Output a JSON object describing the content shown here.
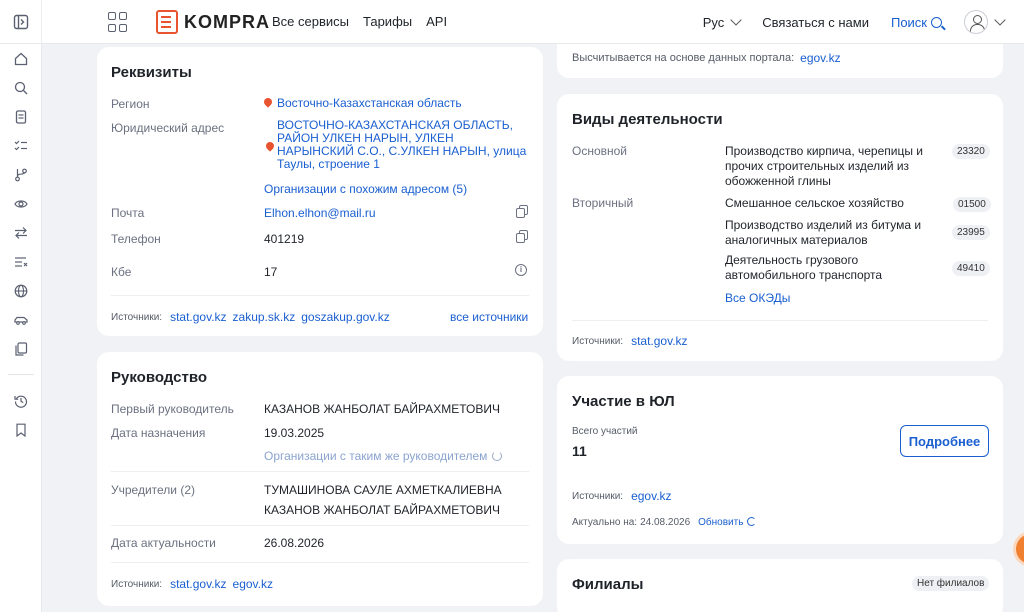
{
  "header": {
    "logo_text": "KOMPRA",
    "nav": [
      "Все сервисы",
      "Тарифы",
      "API"
    ],
    "lang": "Рус",
    "contact": "Связаться с нами",
    "search": "Поиск"
  },
  "rekvizity": {
    "title": "Реквизиты",
    "region_label": "Регион",
    "region_value": "Восточно-Казахстанская область",
    "address_label": "Юридический адрес",
    "address_value": "ВОСТОЧНО-КАЗАХСТАНСКАЯ ОБЛАСТЬ, РАЙОН УЛКЕН НАРЫН, УЛКЕН НАРЫНСКИЙ С.О., С.УЛКЕН НАРЫН, улица Таулы, строение 1",
    "similar_address": "Организации с похожим адресом (5)",
    "email_label": "Почта",
    "email_value": "Elhon.elhon@mail.ru",
    "phone_label": "Телефон",
    "phone_value": "401219",
    "kbe_label": "Кбе",
    "kbe_value": "17",
    "sources_label": "Источники:",
    "sources": [
      "stat.gov.kz",
      "zakup.sk.kz",
      "goszakup.gov.kz"
    ],
    "all_sources": "все источники"
  },
  "rukovodstvo": {
    "title": "Руководство",
    "head_label": "Первый руководитель",
    "head_value": "КАЗАНОВ ЖАНБОЛАТ БАЙРАХМЕТОВИЧ",
    "date_label": "Дата назначения",
    "date_value": "19.03.2025",
    "same_head": "Организации с таким же руководителем",
    "founders_label": "Учредители (2)",
    "founders": [
      "ТУМАШИНОВА САУЛЕ АХМЕТКАЛИЕВНА",
      "КАЗАНОВ ЖАНБОЛАТ БАЙРАХМЕТОВИЧ"
    ],
    "actual_label": "Дата актуальности",
    "actual_value": "26.08.2026",
    "sources_label": "Источники:",
    "sources": [
      "stat.gov.kz",
      "egov.kz"
    ]
  },
  "top_right": {
    "text": "Высчитывается на основе данных портала:",
    "link": "egov.kz"
  },
  "activities": {
    "title": "Виды деятельности",
    "main_label": "Основной",
    "secondary_label": "Вторичный",
    "main": [
      {
        "name": "Производство кирпича, черепицы и прочих строительных изделий из обожженной глины",
        "code": "23320"
      }
    ],
    "secondary": [
      {
        "name": "Смешанное сельское хозяйство",
        "code": "01500"
      },
      {
        "name": "Производство изделий из битума и аналогичных материалов",
        "code": "23995"
      },
      {
        "name": "Деятельность грузового автомобильного транспорта",
        "code": "49410"
      }
    ],
    "all_okeds": "Все ОКЭДы",
    "sources_label": "Источники:",
    "source": "stat.gov.kz"
  },
  "participation": {
    "title": "Участие в ЮЛ",
    "total_label": "Всего участий",
    "total_value": "11",
    "more_button": "Подробнее",
    "sources_label": "Источники:",
    "source": "egov.kz",
    "actual_label": "Актуально на:",
    "actual_date": "24.08.2026",
    "refresh": "Обновить"
  },
  "branches": {
    "title": "Филиалы",
    "badge": "Нет филиалов"
  }
}
